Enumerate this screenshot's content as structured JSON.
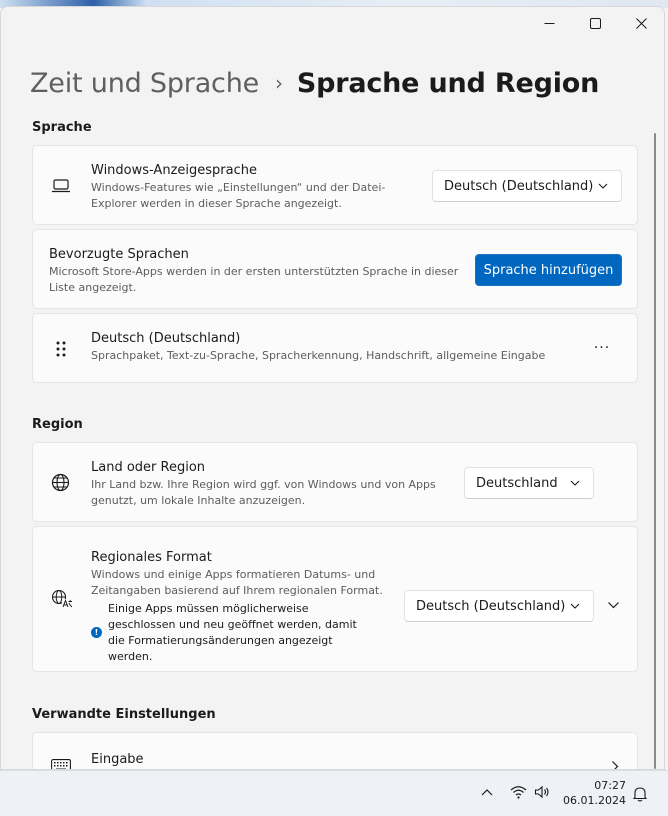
{
  "header": {
    "parent": "Zeit und Sprache",
    "separator": "›",
    "current": "Sprache und Region"
  },
  "sprache_section": {
    "title": "Sprache",
    "display_language": {
      "title": "Windows-Anzeigesprache",
      "desc_line1": "Windows-Features wie „Einstellungen“ und der Datei-",
      "desc_line2": "Explorer werden in dieser Sprache angezeigt.",
      "value": "Deutsch (Deutschland)",
      "icon": "laptop-icon"
    },
    "preferred": {
      "title": "Bevorzugte Sprachen",
      "desc_line1": "Microsoft Store-Apps werden in der ersten unterstützten Sprache in dieser",
      "desc_line2": "Liste angezeigt.",
      "button": "Sprache hinzufügen"
    },
    "language_item": {
      "title": "Deutsch (Deutschland)",
      "desc": "Sprachpaket, Text-zu-Sprache, Spracherkennung, Handschrift, allgemeine Eingabe",
      "more": "···"
    }
  },
  "region_section": {
    "title": "Region",
    "country": {
      "title": "Land oder Region",
      "desc_line1": "Ihr Land bzw. Ihre Region wird ggf. von Windows und von Apps",
      "desc_line2": "genutzt, um lokale Inhalte anzuzeigen.",
      "value": "Deutschland",
      "icon": "globe-icon"
    },
    "format": {
      "title": "Regionales Format",
      "desc_line1": "Windows und einige Apps formatieren Datums- und",
      "desc_line2": "Zeitangaben basierend auf Ihrem regionalen Format.",
      "info_line1": "Einige Apps müssen möglicherweise",
      "info_line2": "geschlossen und neu geöffnet werden, damit",
      "info_line3": "die Formatierungsänderungen angezeigt",
      "info_line4": "werden.",
      "info_glyph": "!",
      "value": "Deutsch (Deutschland)",
      "icon": "language-format-icon"
    }
  },
  "related_section": {
    "title": "Verwandte Einstellungen",
    "input": {
      "title": "Eingabe",
      "icon": "keyboard-icon"
    }
  },
  "taskbar": {
    "time": "07:27",
    "date": "06.01.2024"
  },
  "colors": {
    "accent": "#0067c0",
    "background": "#f3f3f3",
    "card": "#fbfbfb"
  }
}
